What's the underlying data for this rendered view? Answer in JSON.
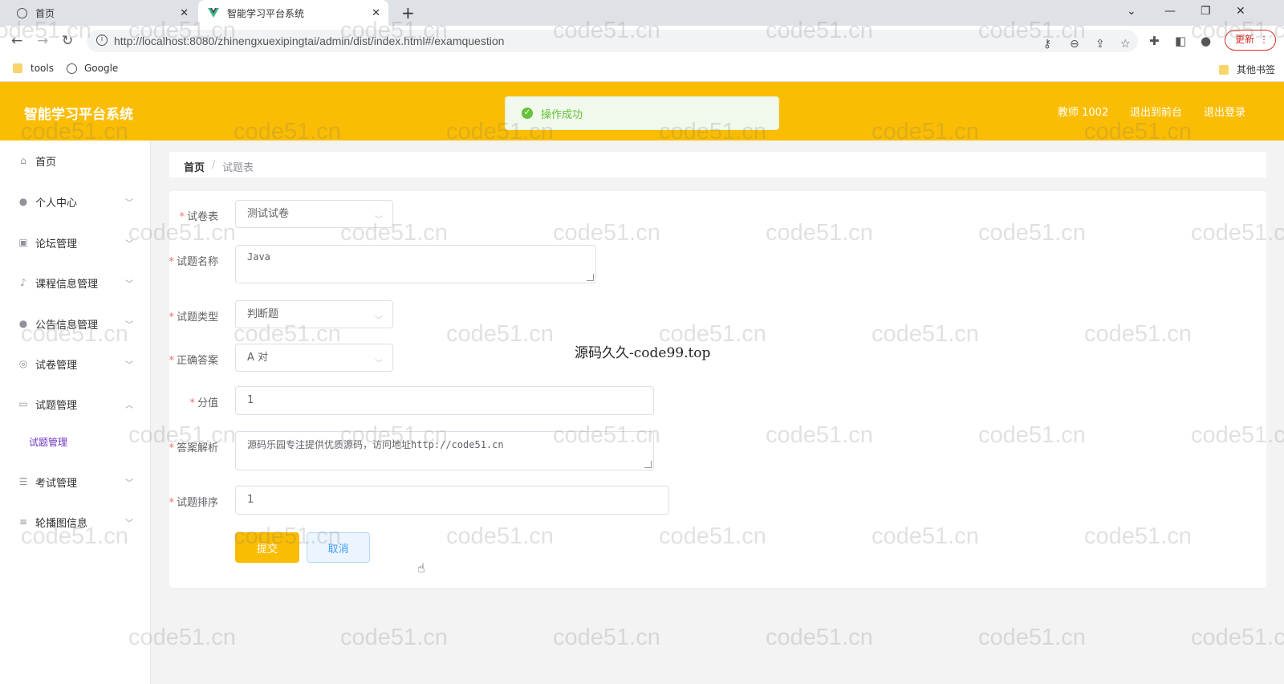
{
  "browser": {
    "tabs": [
      {
        "title": "首页"
      },
      {
        "title": "智能学习平台系统"
      }
    ],
    "new_tab": "+",
    "url": "http://localhost:8080/zhinengxuexipingtai/admin/dist/index.html#/examquestion",
    "update_label": "更新",
    "bookmarks": [
      {
        "label": "tools",
        "icon": "folder-icon"
      },
      {
        "label": "Google",
        "icon": "globe-icon"
      }
    ],
    "other_bookmarks": "其他书签"
  },
  "app": {
    "title": "智能学习平台系统",
    "toast": "操作成功",
    "user": "教师 1002",
    "to_front": "退出到前台",
    "logout": "退出登录"
  },
  "sidebar": {
    "items": [
      {
        "label": "首页",
        "icon": "home-icon"
      },
      {
        "label": "个人中心",
        "icon": "user-icon"
      },
      {
        "label": "论坛管理",
        "icon": "forum-icon"
      },
      {
        "label": "课程信息管理",
        "icon": "mic-icon"
      },
      {
        "label": "公告信息管理",
        "icon": "user-icon"
      },
      {
        "label": "试卷管理",
        "icon": "target-icon"
      },
      {
        "label": "试题管理",
        "icon": "chat-icon"
      },
      {
        "label": "考试管理",
        "icon": "sliders-icon"
      },
      {
        "label": "轮播图信息",
        "icon": "list-icon"
      }
    ],
    "active_sub": "试题管理"
  },
  "breadcrumb": {
    "home": "首页",
    "current": "试题表"
  },
  "form": {
    "paper": {
      "label": "试卷表",
      "value": "测试试卷"
    },
    "name": {
      "label": "试题名称",
      "value": "Java"
    },
    "type": {
      "label": "试题类型",
      "value": "判断题"
    },
    "answer": {
      "label": "正确答案",
      "value": "A 对"
    },
    "score": {
      "label": "分值",
      "value": "1"
    },
    "analysis": {
      "label": "答案解析",
      "value": "源码乐园专注提供优质源码，访问地址http://code51.cn"
    },
    "order": {
      "label": "试题排序",
      "value": "1"
    },
    "submit": "提交",
    "cancel": "取消"
  },
  "overlay": "源码久久-code99.top",
  "watermark": "code51.cn"
}
